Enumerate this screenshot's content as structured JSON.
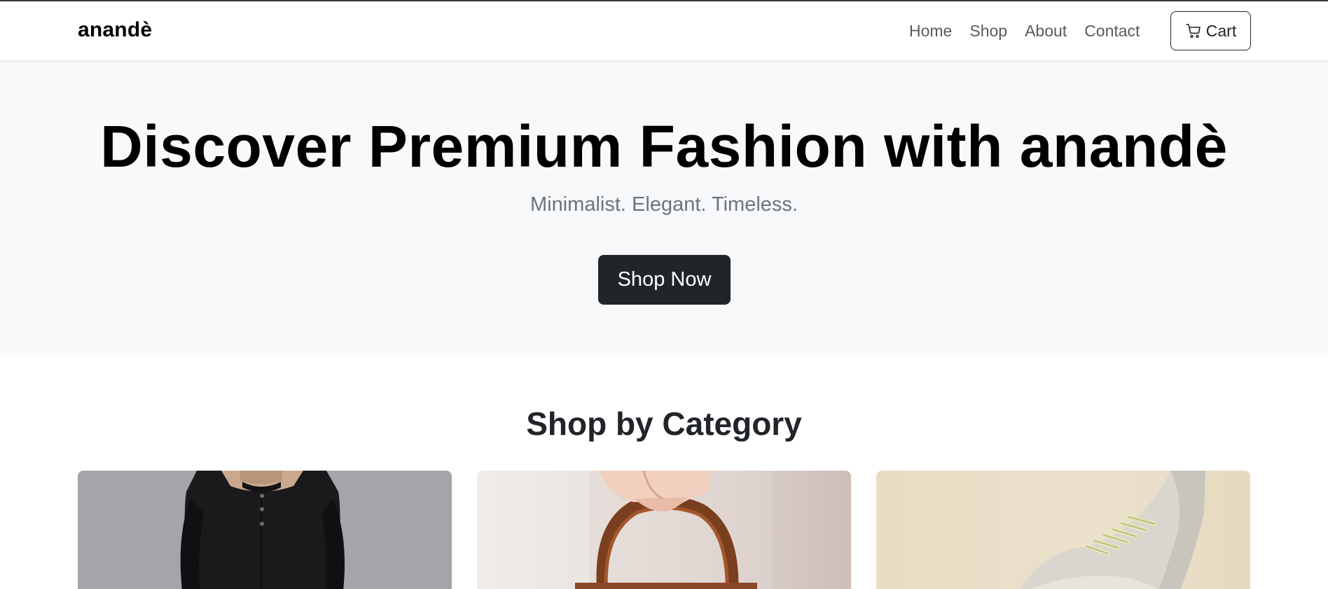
{
  "brand": "anandè",
  "nav": {
    "links": [
      "Home",
      "Shop",
      "About",
      "Contact"
    ],
    "cart_label": "Cart"
  },
  "hero": {
    "title": "Discover Premium Fashion with anandè",
    "subtitle": "Minimalist. Elegant. Timeless.",
    "cta_label": "Shop Now"
  },
  "categories": {
    "title": "Shop by Category"
  },
  "colors": {
    "dark": "#212529",
    "hero_bg": "#f8f9fa",
    "muted": "#6c757d"
  }
}
